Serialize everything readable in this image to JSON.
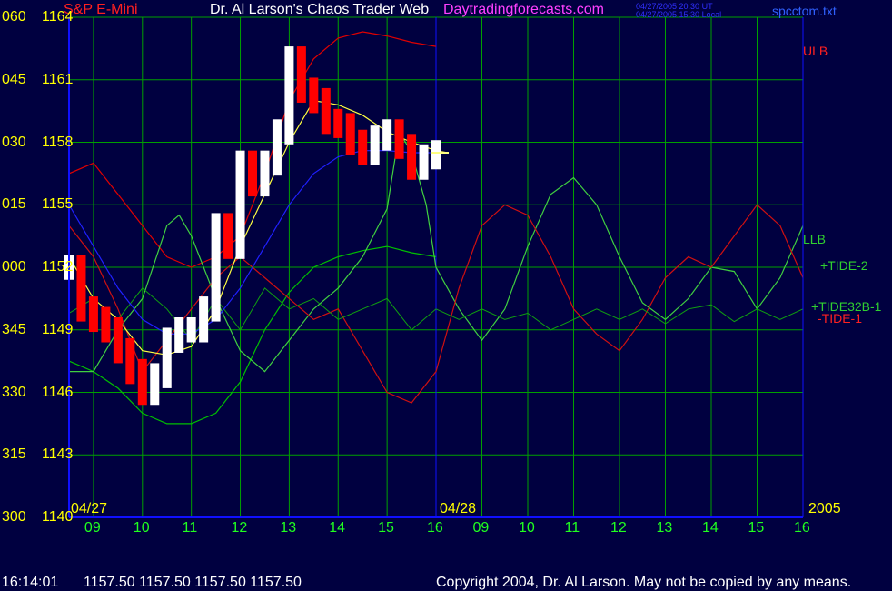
{
  "header": {
    "instrument": "S&P E-Mini",
    "title": "Dr. Al Larson's Chaos Trader Web",
    "site": "Daytradingforecasts.com",
    "stamp_ut": "04/27/2005 20:30 UT",
    "stamp_local": "04/27/2005 15:30 Local",
    "filename": "spcctom.txt"
  },
  "footer": {
    "time": "16:14:01",
    "ohlc": "1157.50 1157.50 1157.50 1157.50",
    "copyright": "Copyright 2004, Dr. Al Larson. May not be copied by any means."
  },
  "colors": {
    "background": "#000040",
    "grid": "#00a000",
    "axis": "#1010ff",
    "price_up": "#ffffff",
    "price_down": "#ff0000",
    "ulb": "#e00000",
    "llb": "#00c000",
    "tide2": "#40d040",
    "tide1": "#d01010",
    "tide32b1": "#10a010",
    "average": "#ffff40",
    "blue_average": "#2020ff",
    "label_yellow": "#ffff00"
  },
  "chart_data": {
    "type": "line",
    "y_left_labels": [
      "060",
      "045",
      "030",
      "015",
      "000",
      "345",
      "330",
      "315",
      "300"
    ],
    "y_right_labels": [
      "1164",
      "1161",
      "1158",
      "1155",
      "1152",
      "1149",
      "1146",
      "1143",
      "1140"
    ],
    "ylim": [
      1140,
      1164
    ],
    "x_labels": [
      "09",
      "10",
      "11",
      "12",
      "13",
      "14",
      "15",
      "16",
      "09",
      "10",
      "11",
      "12",
      "13",
      "14",
      "15",
      "16"
    ],
    "date_labels": [
      "04/27",
      "04/28"
    ],
    "year_label": "2005",
    "hour_range": [
      8.5,
      16
    ],
    "series": [
      {
        "name": "ULB",
        "day": 1,
        "x": [
          8.5,
          9,
          9.5,
          10,
          10.5,
          11,
          11.5,
          12,
          12.5,
          13,
          13.5,
          14,
          14.5,
          15,
          15.5,
          16
        ],
        "y": [
          1156.5,
          1157,
          1155.5,
          1154,
          1152.5,
          1152,
          1152.5,
          1153.5,
          1156.5,
          1160,
          1162,
          1163,
          1163.3,
          1163.1,
          1162.8,
          1162.6
        ]
      },
      {
        "name": "LLB",
        "day": 1,
        "x": [
          8.5,
          9,
          9.5,
          10,
          10.5,
          11,
          11.5,
          12,
          12.5,
          13,
          13.5,
          14,
          14.5,
          15,
          15.5,
          16
        ],
        "y": [
          1147.5,
          1147,
          1146.2,
          1145,
          1144.5,
          1144.5,
          1145,
          1146.5,
          1149,
          1150.8,
          1152,
          1152.5,
          1152.8,
          1153,
          1152.7,
          1152.5
        ]
      },
      {
        "name": "+TIDE-2",
        "x": [
          8.5,
          9,
          9.5,
          10,
          10.5,
          10.75,
          11,
          11.5,
          12,
          12.5,
          13,
          13.5,
          14,
          14.5,
          15,
          15.25,
          15.5,
          15.8,
          16,
          16.5,
          17,
          17.5,
          18,
          18.5,
          19,
          19.5,
          20,
          20.5,
          21,
          21.5,
          22,
          22.5,
          23,
          23.5,
          24
        ],
        "y": [
          1147,
          1147,
          1149,
          1150.5,
          1154,
          1154.5,
          1153.5,
          1150.5,
          1148,
          1147,
          1148.5,
          1150,
          1151,
          1152.5,
          1154.8,
          1158.5,
          1157.5,
          1155,
          1152,
          1150,
          1148.5,
          1150,
          1153,
          1155.5,
          1156.3,
          1155,
          1152.5,
          1150.3,
          1149.5,
          1150.5,
          1152,
          1151.8,
          1150,
          1151.5,
          1154
        ]
      },
      {
        "name": "-TIDE-1",
        "x": [
          8.5,
          9,
          9.5,
          10,
          10.5,
          11,
          11.5,
          12,
          12.5,
          13,
          13.5,
          14,
          14.5,
          15,
          15.5,
          16,
          16.5,
          17,
          17.5,
          18,
          18.5,
          19,
          19.5,
          20,
          20.5,
          21,
          21.5,
          22,
          22.5,
          23,
          23.5,
          24
        ],
        "y": [
          1154,
          1152.5,
          1150,
          1147,
          1148.5,
          1150,
          1151.5,
          1152.5,
          1151.5,
          1150.5,
          1149.5,
          1150,
          1148,
          1146,
          1145.5,
          1147,
          1151,
          1154,
          1155,
          1154.5,
          1152.5,
          1150,
          1148.8,
          1148,
          1149.5,
          1151.5,
          1152.5,
          1152,
          1153.5,
          1155,
          1154,
          1151.5
        ]
      },
      {
        "name": "+TIDE32B-1",
        "x": [
          8.5,
          9,
          9.5,
          10,
          10.5,
          11,
          11.5,
          12,
          12.5,
          13,
          13.5,
          14,
          14.5,
          15,
          15.5,
          16,
          16.5,
          17,
          17.5,
          18,
          18.5,
          19,
          19.5,
          20,
          20.5,
          21,
          21.5,
          22,
          22.5,
          23,
          23.5,
          24
        ],
        "y": [
          1149.8,
          1150.5,
          1149.5,
          1151,
          1150,
          1148.5,
          1150.5,
          1149,
          1151,
          1150,
          1150.5,
          1149.5,
          1150,
          1150.5,
          1149,
          1150,
          1149.5,
          1150,
          1149.5,
          1149.8,
          1149,
          1149.5,
          1150,
          1149.5,
          1150,
          1149.3,
          1150,
          1150.2,
          1149.4,
          1150,
          1149.5,
          1150
        ]
      },
      {
        "name": "price",
        "day": 1,
        "x": [
          8.5,
          8.75,
          9,
          9.25,
          9.5,
          9.75,
          10,
          10.25,
          10.5,
          10.75,
          11,
          11.25,
          11.5,
          11.75,
          12,
          12.25,
          12.5,
          12.75,
          13,
          13.25,
          13.5,
          13.75,
          14,
          14.25,
          14.5,
          14.75,
          15,
          15.25,
          15.5,
          15.75,
          16
        ],
        "y": [
          1152,
          1150,
          1149.5,
          1149,
          1148,
          1147,
          1146,
          1146.8,
          1148.5,
          1149,
          1149,
          1150,
          1154,
          1153,
          1157,
          1156,
          1157,
          1158.5,
          1162,
          1160.5,
          1160,
          1159,
          1158.8,
          1158,
          1157.5,
          1158.2,
          1158.5,
          1157.8,
          1156.8,
          1157.3,
          1157.5
        ]
      },
      {
        "name": "average",
        "day": 1,
        "x": [
          8.5,
          9,
          9.5,
          10,
          10.5,
          11,
          11.5,
          12,
          12.5,
          13,
          13.5,
          14,
          14.5,
          15,
          15.5,
          16,
          16.25
        ],
        "y": [
          1152.5,
          1150.5,
          1149.5,
          1148,
          1147.8,
          1148.2,
          1150,
          1153,
          1155.5,
          1158,
          1160,
          1159.8,
          1159.3,
          1158.5,
          1158,
          1157.6,
          1157.5
        ]
      },
      {
        "name": "blue average",
        "day": 1,
        "x": [
          8.5,
          9,
          9.5,
          10,
          10.5,
          11,
          11.5,
          12,
          12.5,
          13,
          13.5,
          14,
          14.5,
          15,
          15.5,
          16
        ],
        "y": [
          1155,
          1153,
          1151,
          1149.5,
          1148.8,
          1148.8,
          1149.5,
          1151,
          1153,
          1155,
          1156.5,
          1157.3,
          1157.6,
          1157.6,
          1157.5,
          1157.5
        ]
      }
    ],
    "legend": {
      "ulb": "ULB",
      "llb": "LLB",
      "tide2": "+TIDE-2",
      "tide32b1": "+TIDE32B-1",
      "tide1": "-TIDE-1"
    }
  }
}
